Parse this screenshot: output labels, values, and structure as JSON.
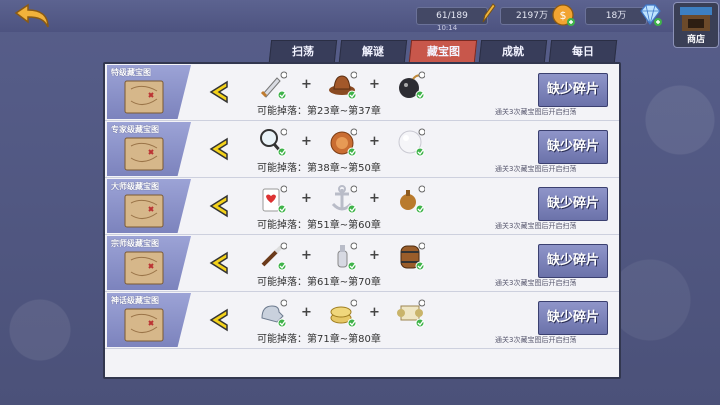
{
  "header": {
    "stamina": "61/189",
    "time": "10:14",
    "gold": "2197万",
    "diamond": "18万",
    "shop_label": "商店"
  },
  "tabs": [
    "扫荡",
    "解谜",
    "藏宝图",
    "成就",
    "每日"
  ],
  "active_tab": 2,
  "rows": [
    {
      "title": "特级藏宝图",
      "drop": "可能掉落：第23章~第37章",
      "button": "缺少碎片",
      "hint": "通关3次藏宝图后开启扫荡",
      "items": [
        "dagger-icon",
        "hat-icon",
        "bomb-icon"
      ]
    },
    {
      "title": "专家级藏宝图",
      "drop": "可能掉落：第38章~第50章",
      "button": "缺少碎片",
      "hint": "通关3次藏宝图后开启扫荡",
      "items": [
        "lens-icon",
        "rope-icon",
        "pearl-icon"
      ]
    },
    {
      "title": "大师级藏宝图",
      "drop": "可能掉落：第51章~第60章",
      "button": "缺少碎片",
      "hint": "通关3次藏宝图后开启扫荡",
      "items": [
        "card-icon",
        "anchor-icon",
        "potion-icon"
      ]
    },
    {
      "title": "宗师级藏宝图",
      "drop": "可能掉落：第61章~第70章",
      "button": "缺少碎片",
      "hint": "通关3次藏宝图后开启扫荡",
      "items": [
        "brush-icon",
        "bottle-icon",
        "barrel-icon"
      ]
    },
    {
      "title": "神话级藏宝图",
      "drop": "可能掉落：第71章~第80章",
      "button": "缺少碎片",
      "hint": "通关3次藏宝图后开启扫荡",
      "items": [
        "gloves-icon",
        "coins-icon",
        "scroll-icon"
      ]
    }
  ]
}
